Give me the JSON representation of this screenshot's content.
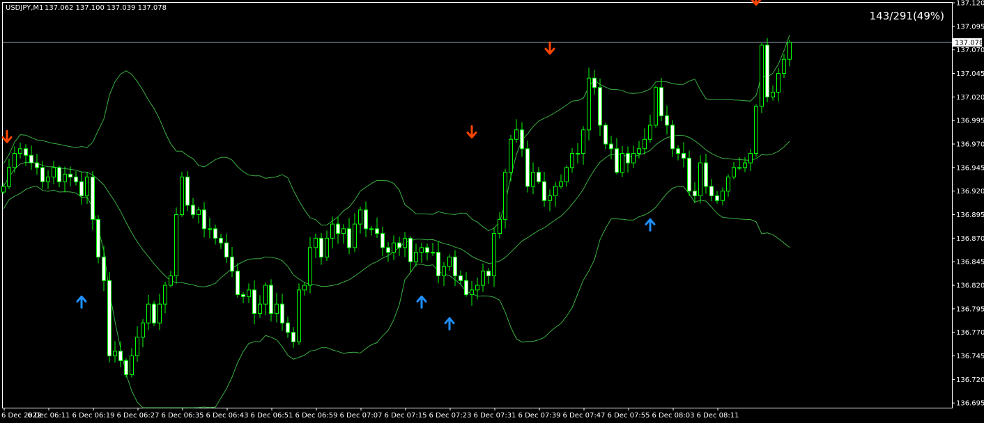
{
  "header": {
    "symbol_label": "USDJPY,M1",
    "ohlc_label": "137.062 137.100 137.039 137.078",
    "stats_label": "143/291(49%)"
  },
  "colors": {
    "background": "#000000",
    "frame": "#ffffff",
    "candle_up_fill": "#000000",
    "candle_down_fill": "#ffffff",
    "candle_outline": "#00ff00",
    "band_line": "#3cb043",
    "bid_line": "#9ab0c0",
    "sell_arrow": "#ff4500",
    "buy_arrow": "#1e90ff"
  },
  "chart_data": {
    "type": "candlestick",
    "symbol": "USDJPY",
    "timeframe": "M1",
    "current_price": 137.078,
    "current_price_label": "137.078",
    "ylim": [
      136.69,
      137.12
    ],
    "y_ticks": [
      137.12,
      137.095,
      137.07,
      137.045,
      137.02,
      136.995,
      136.97,
      136.945,
      136.92,
      136.895,
      136.87,
      136.845,
      136.82,
      136.795,
      136.77,
      136.745,
      136.72,
      136.695
    ],
    "x_tick_labels": [
      "6 Dec 2022",
      "6 Dec 06:11",
      "6 Dec 06:19",
      "6 Dec 06:27",
      "6 Dec 06:35",
      "6 Dec 06:43",
      "6 Dec 06:51",
      "6 Dec 06:59",
      "6 Dec 07:07",
      "6 Dec 07:15",
      "6 Dec 07:23",
      "6 Dec 07:31",
      "6 Dec 07:39",
      "6 Dec 07:47",
      "6 Dec 07:55",
      "6 Dec 08:03",
      "6 Dec 08:11"
    ],
    "candles_close": [
      136.925,
      136.945,
      136.96,
      136.965,
      136.958,
      136.95,
      136.945,
      136.93,
      136.935,
      136.945,
      136.93,
      136.938,
      136.935,
      136.93,
      136.915,
      136.935,
      136.89,
      136.85,
      136.825,
      136.745,
      136.75,
      136.74,
      136.725,
      136.745,
      136.765,
      136.78,
      136.8,
      136.78,
      136.8,
      136.82,
      136.83,
      136.895,
      136.935,
      136.905,
      136.895,
      136.9,
      136.88,
      136.88,
      136.87,
      136.865,
      136.85,
      136.835,
      136.81,
      136.808,
      136.815,
      136.79,
      136.8,
      136.82,
      136.79,
      136.8,
      136.78,
      136.77,
      136.76,
      136.815,
      136.82,
      136.86,
      136.87,
      136.85,
      136.87,
      136.885,
      136.875,
      136.88,
      136.86,
      136.885,
      136.9,
      136.88,
      136.88,
      136.875,
      136.86,
      136.855,
      136.865,
      136.86,
      136.87,
      136.845,
      136.855,
      136.86,
      136.855,
      136.855,
      136.83,
      136.84,
      136.85,
      136.83,
      136.825,
      136.81,
      136.815,
      136.82,
      136.835,
      136.83,
      136.875,
      136.89,
      136.94,
      136.975,
      136.985,
      136.965,
      136.925,
      136.94,
      136.93,
      136.91,
      136.915,
      136.925,
      136.93,
      136.945,
      136.96,
      136.96,
      136.985,
      137.04,
      137.03,
      136.99,
      136.97,
      136.965,
      136.94,
      136.96,
      136.95,
      136.96,
      136.965,
      136.975,
      136.99,
      137.03,
      137.0,
      136.99,
      136.965,
      136.96,
      136.955,
      136.92,
      136.915,
      136.95,
      136.925,
      136.915,
      136.91,
      136.92,
      136.935,
      136.945,
      136.945,
      136.95,
      136.96,
      137.01,
      137.075,
      137.02,
      137.025,
      137.045,
      137.06,
      137.078
    ]
  },
  "signals": {
    "sell": [
      {
        "index": 0,
        "price": 136.972
      },
      {
        "index": 84,
        "price": 136.977
      },
      {
        "index": 98,
        "price": 137.066
      },
      {
        "index": 135,
        "price": 137.118
      }
    ],
    "buy": [
      {
        "index": 14,
        "price": 136.808
      },
      {
        "index": 75,
        "price": 136.808
      },
      {
        "index": 80,
        "price": 136.785
      },
      {
        "index": 116,
        "price": 136.89
      }
    ]
  }
}
